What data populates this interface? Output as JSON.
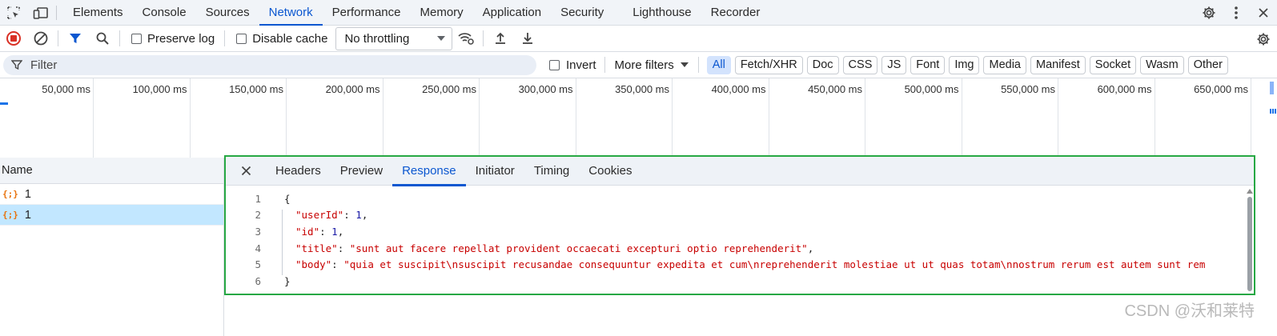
{
  "tabbar": {
    "tabs": [
      "Elements",
      "Console",
      "Sources",
      "Network",
      "Performance",
      "Memory",
      "Application",
      "Security",
      "Lighthouse",
      "Recorder"
    ],
    "active_tab": "Network",
    "icons": [
      "inspect-element-icon",
      "device-toolbar-icon",
      "settings-gear-icon",
      "more-vertical-icon",
      "close-icon"
    ]
  },
  "toolbar": {
    "preserve_log": "Preserve log",
    "disable_cache": "Disable cache",
    "throttling": "No throttling"
  },
  "filterbar": {
    "filter_placeholder": "Filter",
    "invert": "Invert",
    "more_filters": "More filters",
    "chips": [
      "All",
      "Fetch/XHR",
      "Doc",
      "CSS",
      "JS",
      "Font",
      "Img",
      "Media",
      "Manifest",
      "Socket",
      "Wasm",
      "Other"
    ],
    "active_chip": "All"
  },
  "overview": {
    "ticks": [
      "50,000 ms",
      "100,000 ms",
      "150,000 ms",
      "200,000 ms",
      "250,000 ms",
      "300,000 ms",
      "350,000 ms",
      "400,000 ms",
      "450,000 ms",
      "500,000 ms",
      "550,000 ms",
      "600,000 ms",
      "650,000 ms"
    ]
  },
  "requests": {
    "header": "Name",
    "rows": [
      {
        "name": "1",
        "icon": "{;}"
      },
      {
        "name": "1",
        "icon": "{;}"
      }
    ],
    "selected_index": 1
  },
  "detail": {
    "tabs": [
      "Headers",
      "Preview",
      "Response",
      "Initiator",
      "Timing",
      "Cookies"
    ],
    "active_tab": "Response",
    "lines": [
      {
        "n": "1",
        "text": "{"
      },
      {
        "n": "2",
        "key": "\"userId\"",
        "val": "1",
        "type": "num",
        "trail": ","
      },
      {
        "n": "3",
        "key": "\"id\"",
        "val": "1",
        "type": "num",
        "trail": ","
      },
      {
        "n": "4",
        "key": "\"title\"",
        "val": "\"sunt aut facere repellat provident occaecati excepturi optio reprehenderit\"",
        "type": "str",
        "trail": ","
      },
      {
        "n": "5",
        "key": "\"body\"",
        "val": "\"quia et suscipit\\nsuscipit recusandae consequuntur expedita et cum\\nreprehenderit molestiae ut ut quas totam\\nnostrum rerum est autem sunt rem",
        "type": "str",
        "trail": ""
      },
      {
        "n": "6",
        "text": "}"
      }
    ]
  },
  "watermark": "CSDN @沃和莱特",
  "colors": {
    "accent": "#0b57d0",
    "highlight_border": "#27a844",
    "selected_row": "#c2e7ff",
    "record_stop": "#d93025"
  }
}
